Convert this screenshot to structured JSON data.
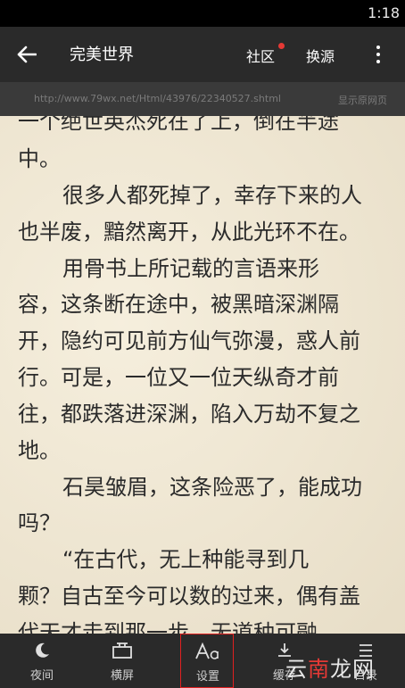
{
  "status": {
    "time": "1:18"
  },
  "toolbar": {
    "title": "完美世界",
    "community": "社区",
    "change_source": "换源"
  },
  "url_bar": {
    "url": "http://www.79wx.net/Html/43976/22340527.shtml",
    "show_source": "显示原网页"
  },
  "content": {
    "lines": [
      "一个绝世英杰死在了上，倒在半途",
      "中。",
      "很多人都死掉了，幸存下来的人",
      "也半废，黯然离开，从此光环不在。",
      "用骨书上所记载的言语来形",
      "容，这条断在途中，被黑暗深渊隔",
      "开，隐约可见前方仙气弥漫，惑人前",
      "行。可是，一位又一位天纵奇才前",
      "往，都跌落进深渊，陷入万劫不复之",
      "地。",
      "石昊皱眉，这条险恶了，能成功",
      "吗？",
      "“在古代，无上种能寻到几",
      "颗？自古至今可以数的过来，偶有盖",
      "代天才走到那一步，无道种可融"
    ]
  },
  "bottom_bar": {
    "night": "夜间",
    "landscape": "横屏",
    "settings": "设置",
    "cache": "缓存",
    "catalog": "目录"
  },
  "watermark": {
    "part1": "云",
    "part2": "南",
    "part3": "龙网"
  }
}
